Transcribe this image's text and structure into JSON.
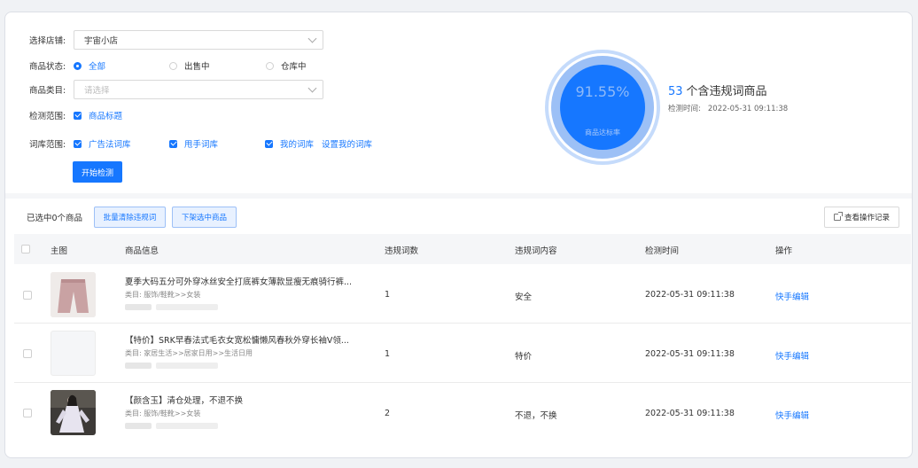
{
  "filters": {
    "shop_label": "选择店铺:",
    "shop_value": "宇宙小店",
    "status_label": "商品状态:",
    "status_options": [
      "全部",
      "出售中",
      "仓库中"
    ],
    "category_label": "商品类目:",
    "category_placeholder": "请选择",
    "scope_label": "检测范围:",
    "scope_option": "商品标题",
    "lexicon_label": "词库范围:",
    "lexicon_options": [
      "广告法词库",
      "甩手词库",
      "我的词库"
    ],
    "set_lexicon_link": "设置我的词库",
    "start_button": "开始检测"
  },
  "stats": {
    "rate": "91.55%",
    "rate_caption": "商品达标率",
    "count": "53",
    "count_label": "个含违规词商品",
    "time_label": "检测时间:",
    "time_value": "2022-05-31 09:11:38"
  },
  "actions": {
    "selected_text": "已选中0个商品",
    "batch_clear": "批量清除违规词",
    "delist": "下架选中商品",
    "view_log": "查看操作记录"
  },
  "table": {
    "headers": [
      "主图",
      "商品信息",
      "违规词数",
      "违规词内容",
      "检测时间",
      "操作"
    ],
    "rows": [
      {
        "title": "夏季大码五分可外穿冰丝安全打底裤女薄款显瘦无痕骑行裤...",
        "category": "类目: 服饰/鞋靴>>女装",
        "count": "1",
        "words": "安全",
        "time": "2022-05-31 09:11:38",
        "op": "快手编辑"
      },
      {
        "title": "【特价】SRK早春法式毛衣女宽松慵懒风春秋外穿长袖V领...",
        "category": "类目: 家居生活>>居家日用>>生活日用",
        "count": "1",
        "words": "特价",
        "time": "2022-05-31 09:11:38",
        "op": "快手编辑"
      },
      {
        "title": "【颜含玉】清仓处理，不退不换",
        "category": "类目: 服饰/鞋靴>>女装",
        "count": "2",
        "words": "不退，不换",
        "time": "2022-05-31 09:11:38",
        "op": "快手编辑"
      }
    ]
  },
  "colors": {
    "primary": "#1677ff",
    "header_bg": "#f5f6f8"
  }
}
